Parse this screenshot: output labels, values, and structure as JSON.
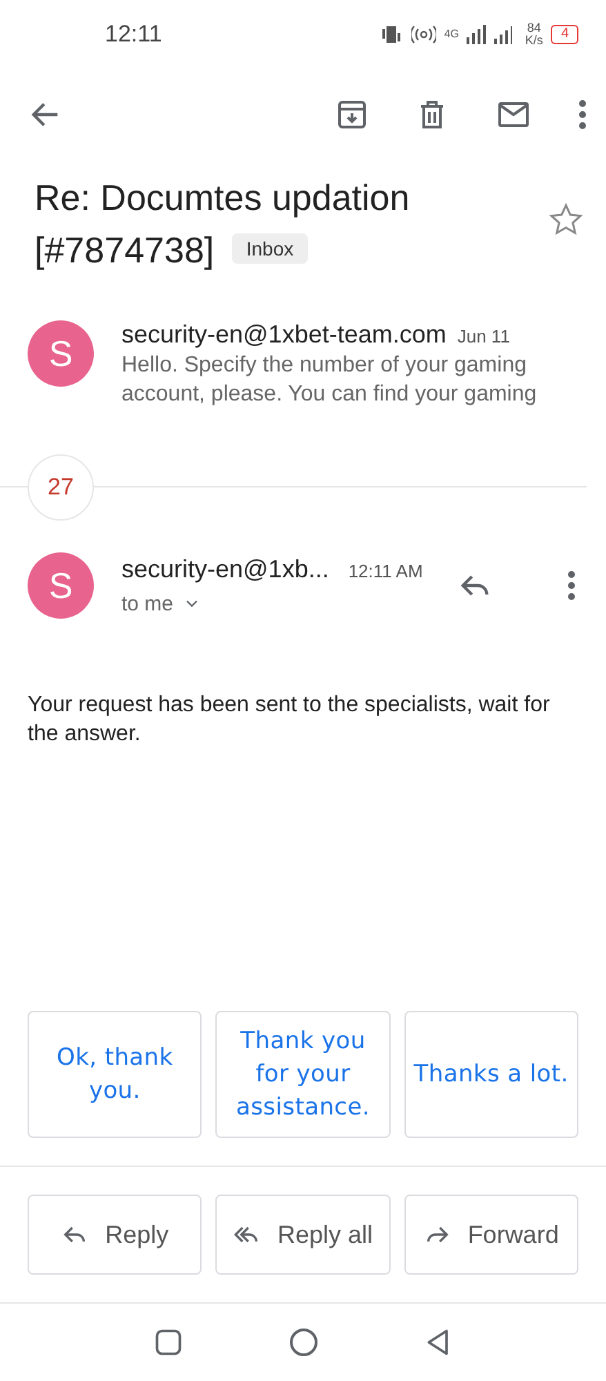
{
  "status_bar": {
    "time": "12:11",
    "network": "4G",
    "speed": "84",
    "speed_unit": "K/s",
    "battery": "4"
  },
  "subject": {
    "title": "Re: Documtes updation [#7874738]",
    "label": "Inbox",
    "starred": false
  },
  "messages": [
    {
      "kind": "collapsed",
      "avatar": "S",
      "sender": "security-en@1xbet-team.com",
      "date": "Jun 11",
      "snippet": "Hello. Specify the number of your gaming account, please. You can find your gaming"
    }
  ],
  "hidden_count": "27",
  "open_message": {
    "avatar": "S",
    "sender": "security-en@1xb...",
    "time": "12:11 AM",
    "recipient": "to me",
    "body": "Your request has been sent to the specialists, wait for the answer."
  },
  "smart_replies": [
    "Ok, thank you.",
    "Thank you for your assistance.",
    "Thanks a lot."
  ],
  "actions": [
    {
      "kind": "reply",
      "label": "Reply"
    },
    {
      "kind": "reply_all",
      "label": "Reply all"
    },
    {
      "kind": "forward",
      "label": "Forward"
    }
  ]
}
